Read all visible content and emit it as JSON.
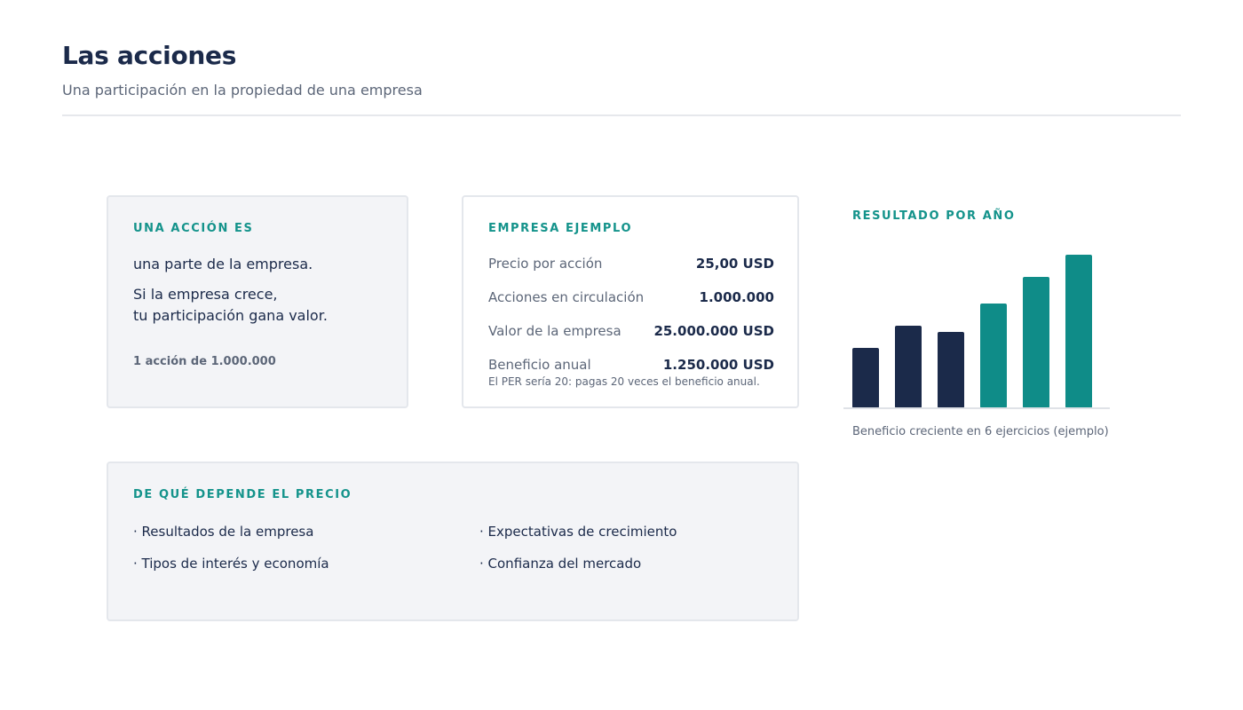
{
  "header": {
    "title": "Las acciones",
    "subtitle": "Una participación en la propiedad de una empresa"
  },
  "share_card": {
    "label": "UNA ACCIÓN ES",
    "lead": "una parte de la empresa.",
    "body_line_1": "Si la empresa crece,",
    "body_line_2": "tu participación gana valor.",
    "note": "1 acción de 1.000.000"
  },
  "company_card": {
    "label": "EMPRESA EJEMPLO",
    "rows": [
      {
        "label": "Precio por acción",
        "value": "25,00 USD"
      },
      {
        "label": "Acciones en circulación",
        "value": "1.000.000"
      },
      {
        "label": "Valor de la empresa",
        "value": "25.000.000 USD"
      },
      {
        "label": "Beneficio anual",
        "value": "1.250.000 USD"
      }
    ],
    "footnote": "El PER sería 20: pagas 20 veces el beneficio anual."
  },
  "chart_block": {
    "label": "RESULTADO POR AÑO",
    "caption": "Beneficio creciente en 6 ejercicios (ejemplo)"
  },
  "chart_data": {
    "type": "bar",
    "title": "RESULTADO POR AÑO",
    "categories": [
      "",
      "",
      "",
      "",
      "",
      ""
    ],
    "values": [
      68,
      93,
      86,
      118,
      148,
      173
    ],
    "bar_colors": [
      "#1b2a4a",
      "#1b2a4a",
      "#1b2a4a",
      "#0f8c88",
      "#0f8c88",
      "#0f8c88"
    ],
    "ylim": [
      0,
      180
    ],
    "grid": false,
    "xlabel": "",
    "ylabel": ""
  },
  "price_card": {
    "label": "DE QUÉ DEPENDE EL PRECIO",
    "factors": [
      "· Resultados de la empresa",
      "· Expectativas de crecimiento",
      "· Tipos de interés y economía",
      "· Confianza del mercado"
    ]
  }
}
